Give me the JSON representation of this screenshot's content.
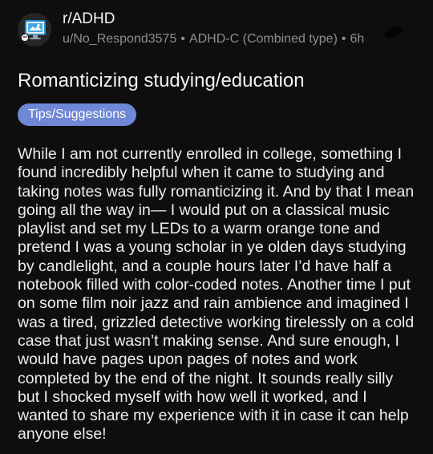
{
  "post": {
    "subreddit": "r/ADHD",
    "author": "u/No_Respond3575",
    "author_flair": "ADHD-C (Combined type)",
    "separator": "•",
    "age": "6h",
    "title": "Romanticizing studying/education",
    "flair": "Tips/Suggestions",
    "body": "While I am not currently enrolled in college, something I found incredibly helpful when it came to studying and taking notes was fully romanticizing it. And by that I mean going all the way in— I would put on a classical music playlist and set my LEDs to a warm orange tone and pretend I was a young scholar in ye olden days studying by candlelight, and a couple hours later I’d have half a notebook filled with color-coded notes. Another time I put on some film noir jazz and rain ambience and imagined I was a tired, grizzled detective working tirelessly on a cold case that just wasn’t making sense. And sure enough, I would have pages upon pages of notes and work completed by the end of the night. It sounds really silly but I shocked myself with how well it worked, and I wanted to share my experience with it in case it can help anyone else!"
  },
  "icons": {
    "avatar": "subreddit-avatar-icon",
    "more": "more-options-icon"
  },
  "colors": {
    "background": "#0e0e0e",
    "flair_background": "#6e87d6",
    "meta_text": "#8f8f8f"
  }
}
